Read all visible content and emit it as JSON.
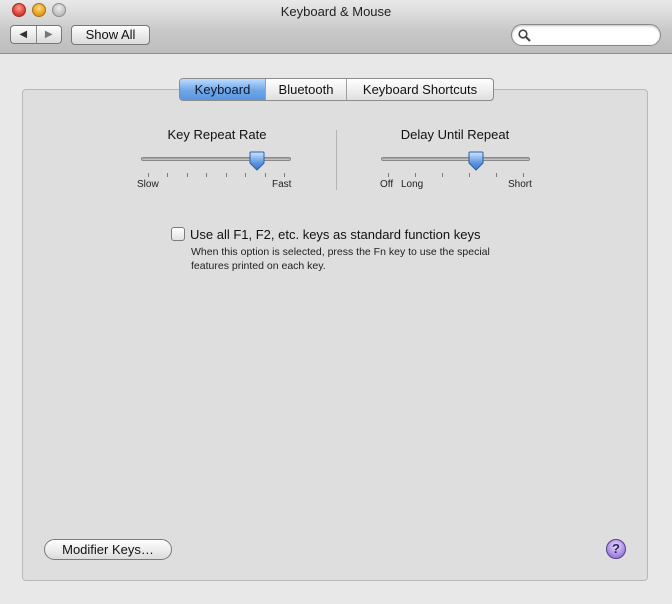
{
  "window": {
    "title": "Keyboard & Mouse"
  },
  "toolbar": {
    "back_icon": "back-arrow-icon",
    "forward_icon": "forward-arrow-icon",
    "show_all_label": "Show All",
    "search_value": "",
    "search_icon": "magnifier-icon"
  },
  "tabs": [
    {
      "label": "Keyboard",
      "active": true
    },
    {
      "label": "Bluetooth",
      "active": false
    },
    {
      "label": "Keyboard Shortcuts",
      "active": false
    }
  ],
  "key_repeat": {
    "title": "Key Repeat Rate",
    "min_label": "Slow",
    "max_label": "Fast",
    "tick_count": 8,
    "value_fraction": 0.8
  },
  "delay_until_repeat": {
    "title": "Delay Until Repeat",
    "off_label": "Off",
    "min_label": "Long",
    "max_label": "Short",
    "tick_count": 6,
    "value_fraction": 0.65
  },
  "function_keys": {
    "checked": false,
    "label": "Use all F1, F2, etc. keys as standard function keys",
    "help": "When this option is selected, press the Fn key to use the special features printed on each key."
  },
  "modifier_button_label": "Modifier Keys…",
  "help_button_label": "?",
  "colors": {
    "accent": "#5996df",
    "help": "#9e7fde"
  }
}
